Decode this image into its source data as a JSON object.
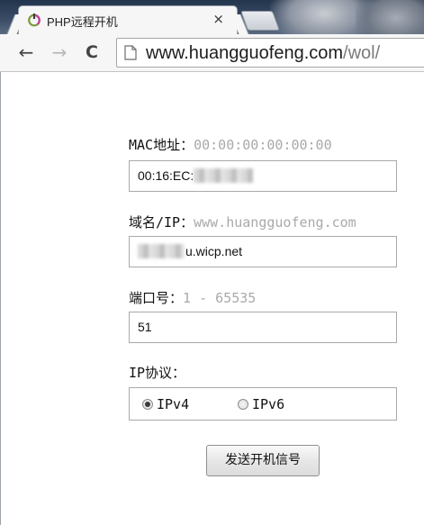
{
  "browser": {
    "tab_title": "PHP远程开机",
    "tab_close": "×",
    "url_host": "www.huangguofeng.com",
    "url_path": "/wol/",
    "nav": {
      "back": "←",
      "forward": "→",
      "reload": "C"
    }
  },
  "form": {
    "mac": {
      "label": "MAC地址：",
      "hint": "00:00:00:00:00:00",
      "value": "00:16:EC:"
    },
    "domain": {
      "label": "域名/IP：",
      "hint": "www.huangguofeng.com",
      "value": "u.wicp.net"
    },
    "port": {
      "label": "端口号：",
      "hint": "1 - 65535",
      "value": "51"
    },
    "protocol": {
      "label": "IP协议：",
      "options": [
        {
          "label": "IPv4",
          "checked": true
        },
        {
          "label": "IPv6",
          "checked": false
        }
      ]
    },
    "submit_label": "发送开机信号"
  }
}
